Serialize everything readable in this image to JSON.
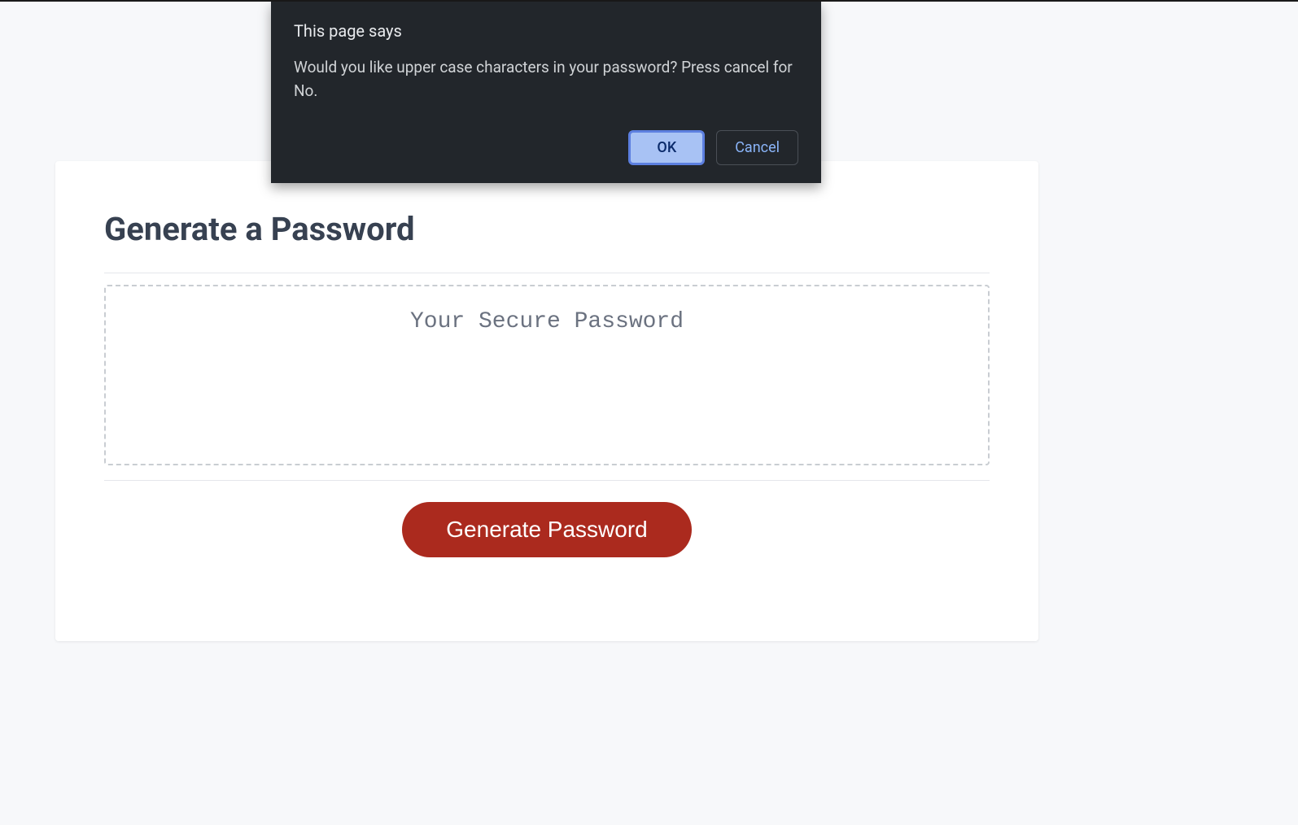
{
  "dialog": {
    "title": "This page says",
    "message": "Would you like upper case characters in your password? Press cancel for No.",
    "ok_label": "OK",
    "cancel_label": "Cancel"
  },
  "card": {
    "title": "Generate a Password",
    "password_placeholder": "Your Secure Password",
    "password_value": "",
    "generate_label": "Generate Password"
  }
}
